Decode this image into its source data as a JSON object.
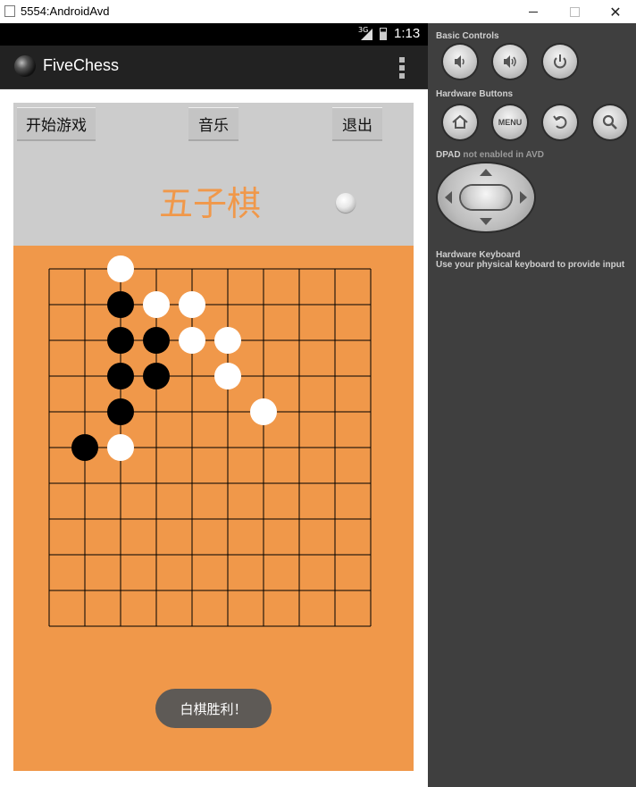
{
  "window": {
    "title": "5554:AndroidAvd"
  },
  "statusbar": {
    "network": "3G",
    "time": "1:13"
  },
  "app": {
    "title": "FiveChess",
    "buttons": {
      "start": "开始游戏",
      "music": "音乐",
      "exit": "退出"
    },
    "game_title": "五子棋",
    "toast": "白棋胜利！"
  },
  "board": {
    "columns": 10,
    "rows": 11,
    "line_color": "#000000",
    "background": "#f0984a",
    "black_stones": [
      [
        2,
        1
      ],
      [
        2,
        2
      ],
      [
        3,
        2
      ],
      [
        2,
        3
      ],
      [
        3,
        3
      ],
      [
        2,
        4
      ],
      [
        1,
        5
      ]
    ],
    "white_stones": [
      [
        2,
        0
      ],
      [
        3,
        1
      ],
      [
        4,
        1
      ],
      [
        4,
        2
      ],
      [
        5,
        2
      ],
      [
        5,
        3
      ],
      [
        6,
        4
      ],
      [
        2,
        5
      ]
    ]
  },
  "controls": {
    "basic_label": "Basic Controls",
    "hardware_label": "Hardware Buttons",
    "menu_label": "MENU",
    "dpad_label": "DPAD",
    "dpad_note": "not enabled in AVD",
    "keyboard_label": "Hardware Keyboard",
    "keyboard_note": "Use your physical keyboard to provide input"
  }
}
